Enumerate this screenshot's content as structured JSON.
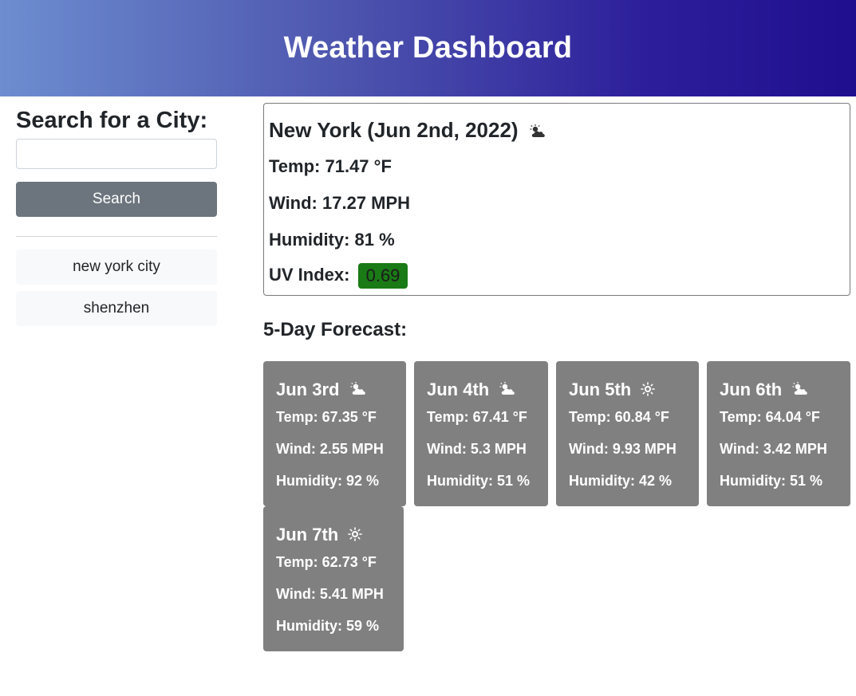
{
  "header": {
    "title": "Weather Dashboard"
  },
  "sidebar": {
    "heading": "Search for a City:",
    "search_value": "",
    "search_placeholder": "",
    "search_button_label": "Search",
    "history": [
      "new york city",
      "shenzhen"
    ]
  },
  "current": {
    "city_date": "New York (Jun 2nd, 2022)",
    "icon": "cloud-sun-icon",
    "temp": "Temp: 71.47 °F",
    "wind": "Wind: 17.27 MPH",
    "humidity": "Humidity: 81 %",
    "uv_label": "UV Index:",
    "uv_value": "0.69",
    "uv_color": "#1a7a16"
  },
  "forecast": {
    "title": "5-Day Forecast:",
    "card_color": "#808080",
    "days": [
      {
        "date": "Jun 3rd",
        "icon": "cloud-sun-icon",
        "temp": "Temp: 67.35 °F",
        "wind": "Wind: 2.55 MPH",
        "humidity": "Humidity: 92 %"
      },
      {
        "date": "Jun 4th",
        "icon": "cloud-sun-icon",
        "temp": "Temp: 67.41 °F",
        "wind": "Wind: 5.3 MPH",
        "humidity": "Humidity: 51 %"
      },
      {
        "date": "Jun 5th",
        "icon": "sun-icon",
        "temp": "Temp: 60.84 °F",
        "wind": "Wind: 9.93 MPH",
        "humidity": "Humidity: 42 %"
      },
      {
        "date": "Jun 6th",
        "icon": "cloud-sun-icon",
        "temp": "Temp: 64.04 °F",
        "wind": "Wind: 3.42 MPH",
        "humidity": "Humidity: 51 %"
      },
      {
        "date": "Jun 7th",
        "icon": "sun-icon",
        "temp": "Temp: 62.73 °F",
        "wind": "Wind: 5.41 MPH",
        "humidity": "Humidity: 59 %"
      }
    ]
  }
}
